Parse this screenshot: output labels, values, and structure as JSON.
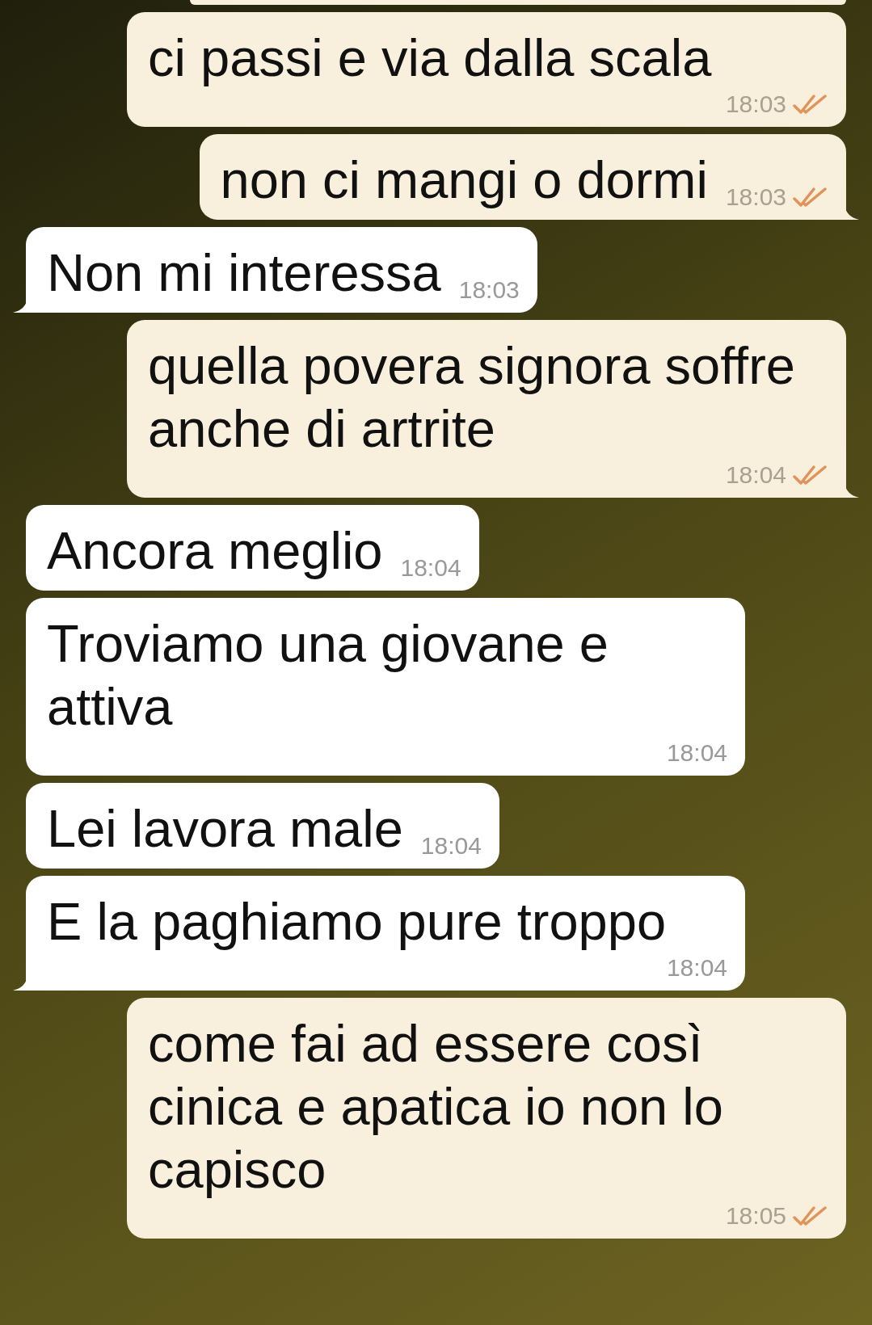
{
  "messages": [
    {
      "kind": "sent",
      "text": "ci passi e via dalla scala",
      "time": "18:03",
      "read": true,
      "tail": false
    },
    {
      "kind": "sent",
      "text": "non ci mangi o dormi",
      "time": "18:03",
      "read": true,
      "tail": true
    },
    {
      "kind": "received",
      "text": "Non mi interessa",
      "time": "18:03",
      "tail": true
    },
    {
      "kind": "sent",
      "text": "quella povera signora soffre anche di artrite",
      "time": "18:04",
      "read": true,
      "tail": true
    },
    {
      "kind": "received",
      "text": "Ancora meglio",
      "time": "18:04",
      "tail": false
    },
    {
      "kind": "received",
      "text": "Troviamo una giovane e attiva",
      "time": "18:04",
      "tail": false
    },
    {
      "kind": "received",
      "text": "Lei lavora male",
      "time": "18:04",
      "tail": false
    },
    {
      "kind": "received",
      "text": "E la paghiamo pure troppo",
      "time": "18:04",
      "tail": true
    },
    {
      "kind": "sent",
      "text": "come fai ad essere così cinica e apatica io non lo capisco",
      "time": "18:05",
      "read": true,
      "tail": false
    }
  ]
}
